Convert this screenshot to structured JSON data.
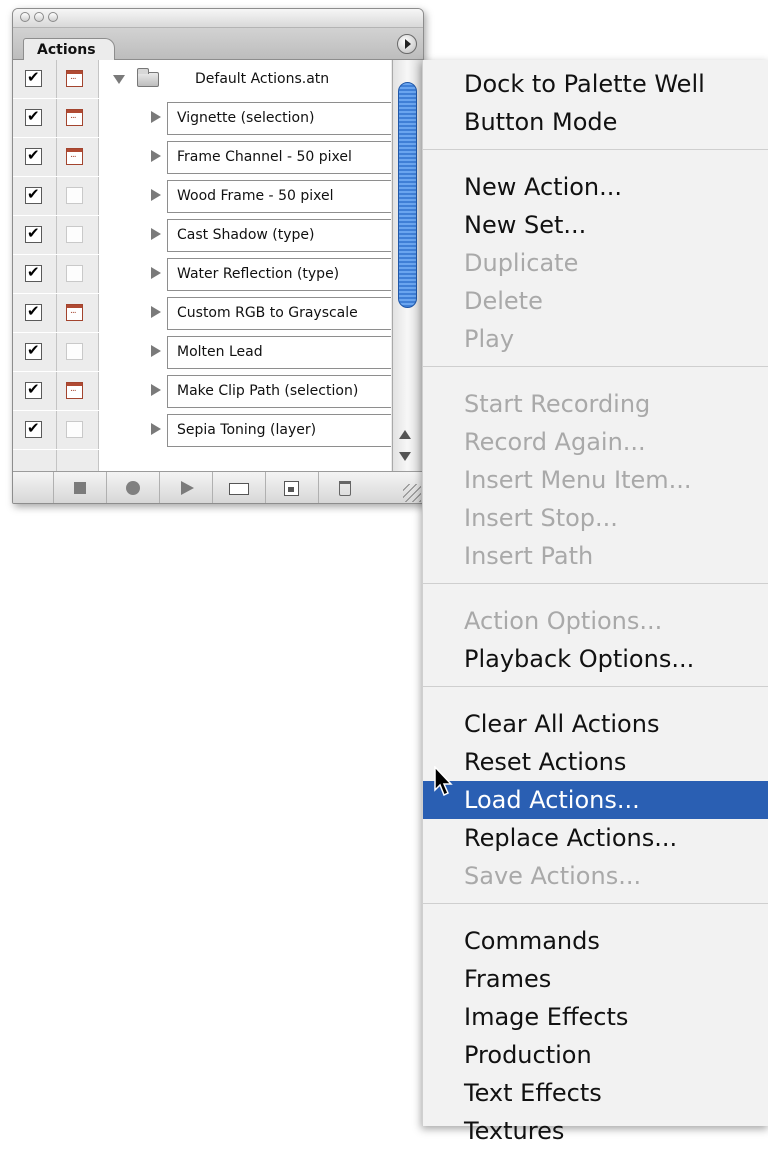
{
  "palette": {
    "tab_label": "Actions",
    "set_name": "Default Actions.atn",
    "actions": [
      {
        "name": "Vignette (selection)",
        "dialog": true
      },
      {
        "name": "Frame Channel - 50 pixel",
        "dialog": true
      },
      {
        "name": "Wood Frame - 50 pixel",
        "dialog": false
      },
      {
        "name": "Cast Shadow (type)",
        "dialog": false
      },
      {
        "name": "Water Reflection (type)",
        "dialog": false
      },
      {
        "name": "Custom RGB to Grayscale",
        "dialog": true
      },
      {
        "name": "Molten Lead",
        "dialog": false
      },
      {
        "name": "Make Clip Path (selection)",
        "dialog": true
      },
      {
        "name": "Sepia Toning (layer)",
        "dialog": false
      }
    ],
    "toolbar_icons": [
      "stop-icon",
      "record-icon",
      "play-icon",
      "new-set-icon",
      "new-action-icon",
      "trash-icon"
    ]
  },
  "menu": {
    "items": [
      {
        "label": "Dock to Palette Well",
        "enabled": true
      },
      {
        "label": "Button Mode",
        "enabled": true
      },
      {
        "label": "New Action...",
        "enabled": true
      },
      {
        "label": "New Set...",
        "enabled": true
      },
      {
        "label": "Duplicate",
        "enabled": false
      },
      {
        "label": "Delete",
        "enabled": false
      },
      {
        "label": "Play",
        "enabled": false
      },
      {
        "label": "Start Recording",
        "enabled": false
      },
      {
        "label": "Record Again...",
        "enabled": false
      },
      {
        "label": "Insert Menu Item...",
        "enabled": false
      },
      {
        "label": "Insert Stop...",
        "enabled": false
      },
      {
        "label": "Insert Path",
        "enabled": false
      },
      {
        "label": "Action Options...",
        "enabled": false
      },
      {
        "label": "Playback Options...",
        "enabled": true
      },
      {
        "label": "Clear All Actions",
        "enabled": true
      },
      {
        "label": "Reset Actions",
        "enabled": true
      },
      {
        "label": "Load Actions...",
        "enabled": true,
        "highlighted": true
      },
      {
        "label": "Replace Actions...",
        "enabled": true
      },
      {
        "label": "Save Actions...",
        "enabled": false
      },
      {
        "label": "Commands",
        "enabled": true
      },
      {
        "label": "Frames",
        "enabled": true
      },
      {
        "label": "Image Effects",
        "enabled": true
      },
      {
        "label": "Production",
        "enabled": true
      },
      {
        "label": "Text Effects",
        "enabled": true
      },
      {
        "label": "Textures",
        "enabled": true
      }
    ]
  },
  "colors": {
    "highlight": "#2a5fb3",
    "disabled_text": "#a9a9a9",
    "dialog_icon": "#b04a33",
    "scroll_thumb": "#3f7fd6"
  }
}
